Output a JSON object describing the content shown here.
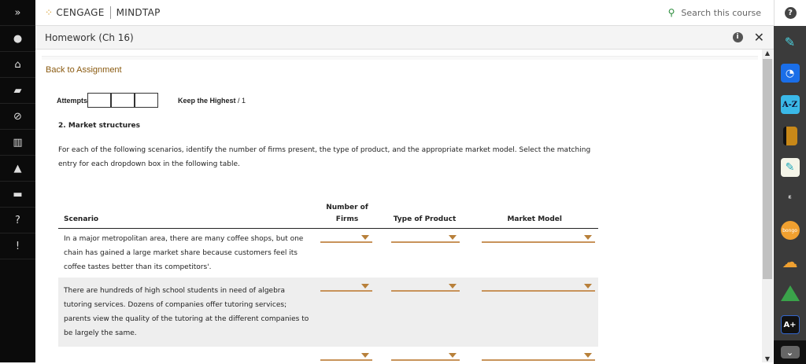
{
  "header": {
    "brand": "CENGAGE",
    "product": "MINDTAP",
    "search_label": "Search this course"
  },
  "titlebar": {
    "title": "Homework (Ch 16)"
  },
  "content": {
    "back_link": "Back to Assignment",
    "attempts_label": "Attempts",
    "keep_label": "Keep the Highest",
    "keep_value": "/ 1",
    "question_title": "2. Market structures",
    "intro": "For each of the following scenarios, identify the number of firms present, the type of product, and the appropriate market model. Select the matching entry for each dropdown box in the following table.",
    "table": {
      "headers": [
        "Scenario",
        "Number of Firms",
        "Type of Product",
        "Market Model"
      ],
      "rows": [
        {
          "scenario": "In a major metropolitan area, there are many coffee shops, but one chain has gained a large market share because customers feel its coffee tastes better than its competitors'."
        },
        {
          "scenario": "There are hundreds of high school students in need of algebra tutoring services. Dozens of companies offer tutoring services; parents view the quality of the tutoring at the different companies to be largely the same."
        },
        {
          "scenario": ""
        }
      ]
    }
  },
  "right_tools": [
    "highlighter-icon",
    "rss-icon",
    "glossary-az-icon",
    "book-icon",
    "notes-icon",
    "readspeaker-icon",
    "bongo-icon",
    "onedrive-icon",
    "google-drive-icon",
    "aplus-icon"
  ],
  "right_tools_text": {
    "az": "A-Z",
    "bongo": "bongo",
    "aplus": "A+"
  },
  "colors": {
    "accent": "#c8935a",
    "link": "#8a5a10",
    "sidebar": "#0b0b0b",
    "toolbar": "#3b3b3b"
  }
}
